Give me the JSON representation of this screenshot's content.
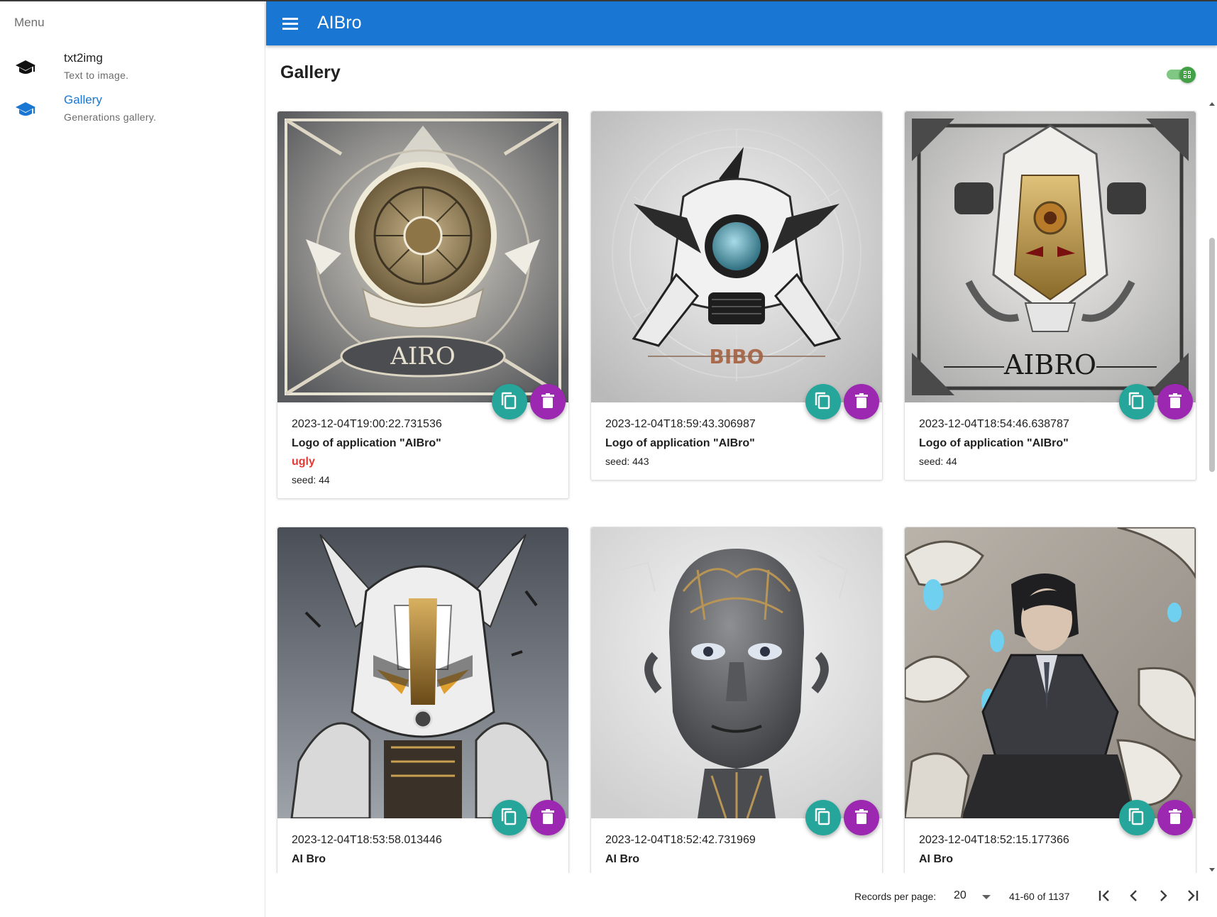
{
  "drawer": {
    "title": "Menu",
    "items": [
      {
        "label": "txt2img",
        "subtitle": "Text to image.",
        "icon": "school-icon",
        "active": false
      },
      {
        "label": "Gallery",
        "subtitle": "Generations gallery.",
        "icon": "school-icon",
        "active": true
      }
    ]
  },
  "appbar": {
    "title": "AIBro",
    "menu_icon": "hamburger-menu-icon"
  },
  "page": {
    "title": "Gallery",
    "view_toggle": {
      "on": true,
      "icon": "grid-view-icon"
    }
  },
  "gallery": {
    "cards": [
      {
        "date": "2023-12-04T19:00:22.731536",
        "prompt": "Logo of application \"AIBro\"",
        "negative": "ugly",
        "seed": "seed: 44",
        "art_text": "AIRO"
      },
      {
        "date": "2023-12-04T18:59:43.306987",
        "prompt": "Logo of application \"AIBro\"",
        "negative": "",
        "seed": "seed: 443",
        "art_text": "BIBO"
      },
      {
        "date": "2023-12-04T18:54:46.638787",
        "prompt": "Logo of application \"AIBro\"",
        "negative": "",
        "seed": "seed: 44",
        "art_text": "AIBRO"
      },
      {
        "date": "2023-12-04T18:53:58.013446",
        "prompt": "AI Bro",
        "negative": "",
        "seed": "",
        "art_text": ""
      },
      {
        "date": "2023-12-04T18:52:42.731969",
        "prompt": "AI Bro",
        "negative": "",
        "seed": "",
        "art_text": ""
      },
      {
        "date": "2023-12-04T18:52:15.177366",
        "prompt": "AI Bro",
        "negative": "",
        "seed": "",
        "art_text": ""
      }
    ],
    "copy_icon": "content-copy-icon",
    "delete_icon": "delete-icon"
  },
  "pagination": {
    "records_label": "Records per page:",
    "records_per_page": "20",
    "range": "41-60 of 1137",
    "buttons": [
      "first-page-icon",
      "previous-page-icon",
      "next-page-icon",
      "last-page-icon"
    ]
  },
  "colors": {
    "primary": "#1976d2",
    "copy_button": "#26a69a",
    "delete_button": "#9c27b0",
    "negative_text": "#e53935",
    "toggle": "#43a047"
  }
}
